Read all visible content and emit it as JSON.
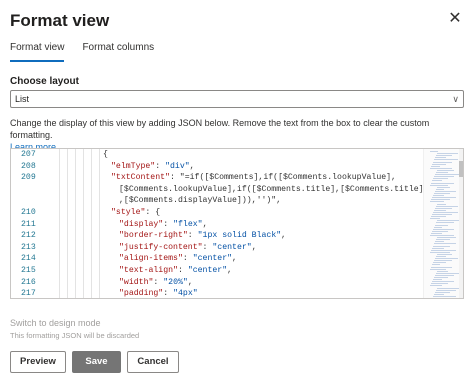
{
  "panel": {
    "title": "Format view",
    "close_glyph": "✕"
  },
  "tabs": [
    {
      "label": "Format view",
      "active": true
    },
    {
      "label": "Format columns",
      "active": false
    }
  ],
  "layout": {
    "label": "Choose layout",
    "value": "List",
    "chevron_glyph": "∨"
  },
  "description": {
    "text": "Change the display of this view by adding JSON below. Remove the text from the box to clear the custom formatting.",
    "link": "Learn more"
  },
  "editor": {
    "line_numbers": [
      "207",
      "208",
      "209",
      "",
      "",
      "210",
      "211",
      "212",
      "213",
      "214",
      "215",
      "216",
      "217"
    ],
    "lines": [
      "{",
      "\"elmType\": \"div\",",
      "\"txtContent\": \"=if([$Comments],if([$Comments.lookupValue],",
      "[$Comments.lookupValue],if([$Comments.title],[$Comments.title]",
      ",[$Comments.displayValue])),'')\",",
      "\"style\": {",
      "\"display\": \"flex\",",
      "\"border-right\": \"1px solid Black\",",
      "\"justify-content\": \"center\",",
      "\"align-items\": \"center\",",
      "\"text-align\": \"center\",",
      "\"width\": \"20%\",",
      "\"padding\": \"4px\""
    ]
  },
  "footer": {
    "switch_label": "Switch to design mode",
    "warning": "This formatting JSON will be discarded",
    "preview_label": "Preview",
    "save_label": "Save",
    "cancel_label": "Cancel"
  },
  "colors": {
    "accent": "#0f6cbd",
    "save_disabled": "#757575",
    "json_key": "#a31515",
    "json_string": "#0451a5"
  }
}
